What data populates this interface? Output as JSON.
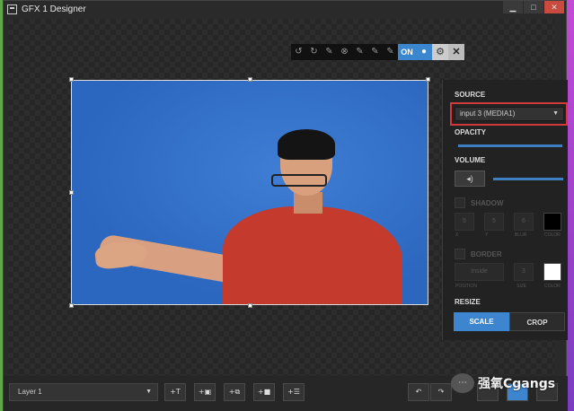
{
  "window": {
    "title": "GFX 1 Designer",
    "min": "▁",
    "max": "□",
    "close": "✕"
  },
  "float_toolbar": {
    "icons": [
      "rotate-left-icon",
      "rotate-right-icon",
      "pen-icon",
      "circle-x-icon",
      "pen-icon",
      "pen-icon",
      "pen-icon"
    ],
    "glyphs": [
      "↺",
      "↻",
      "✎",
      "⊗",
      "✎",
      "✎",
      "✎"
    ],
    "on_label": "ON",
    "person_glyph": "👤",
    "gear_glyph": "⚙",
    "close_glyph": "✕"
  },
  "panel": {
    "source_label": "SOURCE",
    "source_value": "input 3 (MEDIA1)",
    "opacity_label": "OPACITY",
    "volume_label": "VOLUME",
    "volume_glyph": "◂)",
    "shadow_label": "SHADOW",
    "shadow_fields": [
      "5",
      "5",
      "6"
    ],
    "shadow_captions": [
      "X",
      "Y",
      "BLUR",
      "COLOR"
    ],
    "border_label": "BORDER",
    "border_position": "Inside",
    "border_size": "3",
    "border_captions": [
      "POSITION",
      "SIZE",
      "COLOR"
    ],
    "resize_label": "RESIZE",
    "scale_label": "SCALE",
    "crop_label": "CROP",
    "colors": {
      "accent": "#3d86cf",
      "highlight": "#d03a3a",
      "shadow_color": "#000000",
      "border_color": "#ffffff"
    }
  },
  "bottom": {
    "layer_value": "Layer 1",
    "buttons": [
      "+T",
      "+▣",
      "+⧉",
      "+■",
      "+☰"
    ],
    "button_icons": [
      "add-text-icon",
      "add-image-icon",
      "add-layers-icon",
      "add-video-icon",
      "add-list-icon"
    ],
    "undo": "↶",
    "redo": "↷"
  },
  "watermark": {
    "text": "强氧Cgangs"
  }
}
